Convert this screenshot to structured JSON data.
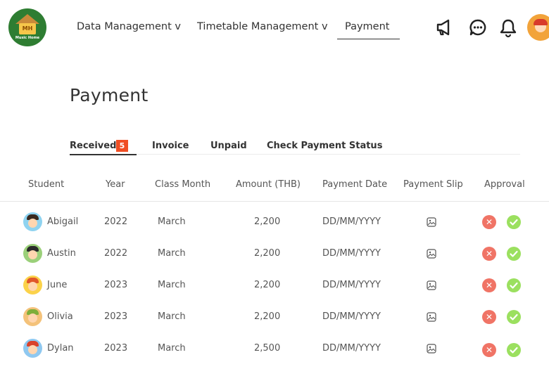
{
  "brand": {
    "logo_text": "MH",
    "logo_sub": "Music Home"
  },
  "nav": {
    "items": [
      {
        "label": "Data Management v"
      },
      {
        "label": "Timetable Management v"
      },
      {
        "label": "Payment",
        "active": true
      }
    ]
  },
  "header_icons": [
    "megaphone-icon",
    "chat-icon",
    "bell-icon"
  ],
  "page": {
    "title": "Payment"
  },
  "tabs": [
    {
      "label": "Received",
      "badge": "5",
      "active": true
    },
    {
      "label": "Invoice"
    },
    {
      "label": "Unpaid"
    },
    {
      "label": "Check Payment Status"
    }
  ],
  "table": {
    "columns": [
      "Student",
      "Year",
      "Class Month",
      "Amount (THB)",
      "Payment Date",
      "Payment Slip",
      "Approval"
    ],
    "rows": [
      {
        "student": "Abigail",
        "year": "2022",
        "month": "March",
        "amount": "2,200",
        "date": "DD/MM/YYYY"
      },
      {
        "student": "Austin",
        "year": "2022",
        "month": "March",
        "amount": "2,200",
        "date": "DD/MM/YYYY"
      },
      {
        "student": "June",
        "year": "2023",
        "month": "March",
        "amount": "2,200",
        "date": "DD/MM/YYYY"
      },
      {
        "student": "Olivia",
        "year": "2023",
        "month": "March",
        "amount": "2,200",
        "date": "DD/MM/YYYY"
      },
      {
        "student": "Dylan",
        "year": "2023",
        "month": "March",
        "amount": "2,500",
        "date": "DD/MM/YYYY"
      }
    ]
  },
  "colors": {
    "badge": "#f04e23",
    "reject": "#f07466",
    "approve": "#9be05f",
    "logo_bg": "#2e7d32"
  }
}
